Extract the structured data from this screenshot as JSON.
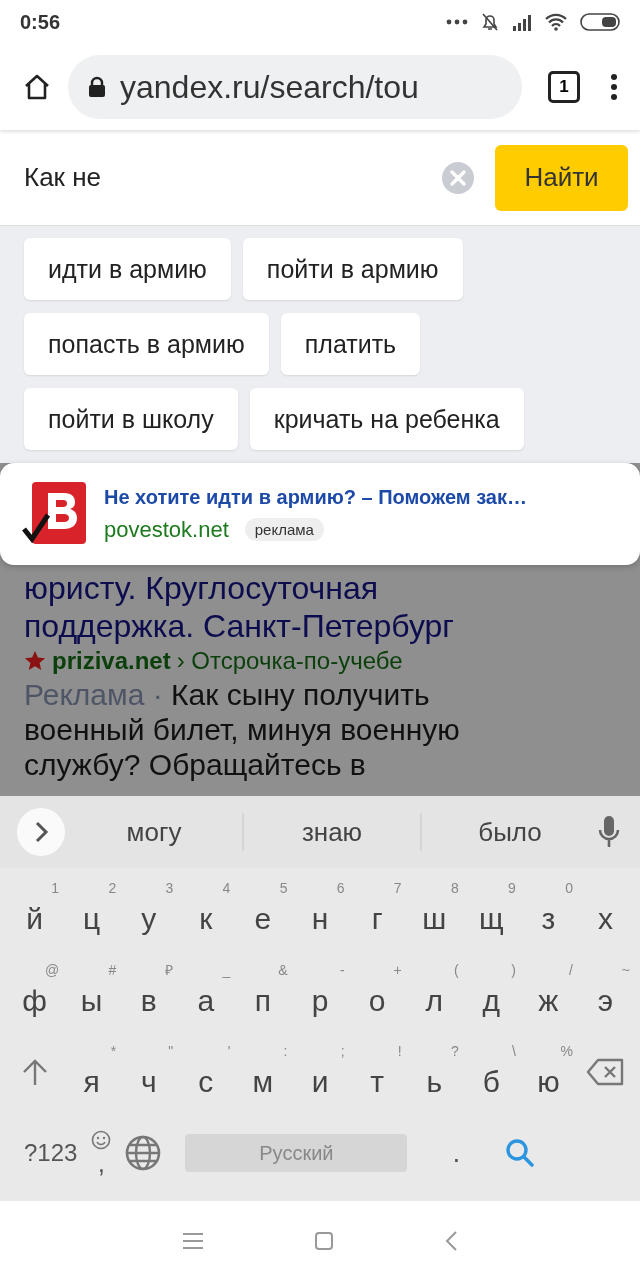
{
  "status_bar": {
    "time": "0:56"
  },
  "browser": {
    "url": "yandex.ru/search/tou",
    "tab_count": "1"
  },
  "search": {
    "value": "Как не",
    "button": "Найти"
  },
  "suggestions": [
    "идти в армию",
    "пойти в армию",
    "попасть в армию",
    "платить",
    "пойти в школу",
    "кричать на ребенка"
  ],
  "ad_card": {
    "title": "Не хотите идти в армию? – Поможем зак…",
    "domain": "povestok.net",
    "badge": "реклама"
  },
  "result": {
    "title_lines": [
      "юристу. Круглосуточная",
      "поддержка. Санкт-Петербург"
    ],
    "domain": "priziva.net",
    "path": "› Отсрочка-по-учебе",
    "label": "Реклама",
    "separator": "·",
    "snippet": "Как сыну получить военный билет, минуя военную службу? Обращайтесь в"
  },
  "keyboard": {
    "predictions": [
      "могу",
      "знаю",
      "было"
    ],
    "rows": [
      [
        {
          "key": "й",
          "hint": "1"
        },
        {
          "key": "ц",
          "hint": "2"
        },
        {
          "key": "у",
          "hint": "3"
        },
        {
          "key": "к",
          "hint": "4"
        },
        {
          "key": "е",
          "hint": "5"
        },
        {
          "key": "н",
          "hint": "6"
        },
        {
          "key": "г",
          "hint": "7"
        },
        {
          "key": "ш",
          "hint": "8"
        },
        {
          "key": "щ",
          "hint": "9"
        },
        {
          "key": "з",
          "hint": "0"
        },
        {
          "key": "х"
        }
      ],
      [
        {
          "key": "ф",
          "hint": "@"
        },
        {
          "key": "ы",
          "hint": "#"
        },
        {
          "key": "в",
          "hint": "₽"
        },
        {
          "key": "а",
          "hint": "_"
        },
        {
          "key": "п",
          "hint": "&"
        },
        {
          "key": "р",
          "hint": "-"
        },
        {
          "key": "о",
          "hint": "+"
        },
        {
          "key": "л",
          "hint": "("
        },
        {
          "key": "д",
          "hint": ")"
        },
        {
          "key": "ж",
          "hint": "/"
        },
        {
          "key": "э",
          "hint": "~"
        }
      ],
      [
        {
          "kind": "shift"
        },
        {
          "key": "я",
          "hint": "*"
        },
        {
          "key": "ч",
          "hint": "\""
        },
        {
          "key": "с",
          "hint": "'"
        },
        {
          "key": "м",
          "hint": ":"
        },
        {
          "key": "и",
          "hint": ";"
        },
        {
          "key": "т",
          "hint": "!"
        },
        {
          "key": "ь",
          "hint": "?"
        },
        {
          "key": "б",
          "hint": "\\"
        },
        {
          "key": "ю",
          "hint": "%"
        },
        {
          "kind": "backspace"
        }
      ]
    ],
    "symbols_key": "?123",
    "comma_key": ",",
    "space_label": "Русский",
    "period_key": "."
  }
}
